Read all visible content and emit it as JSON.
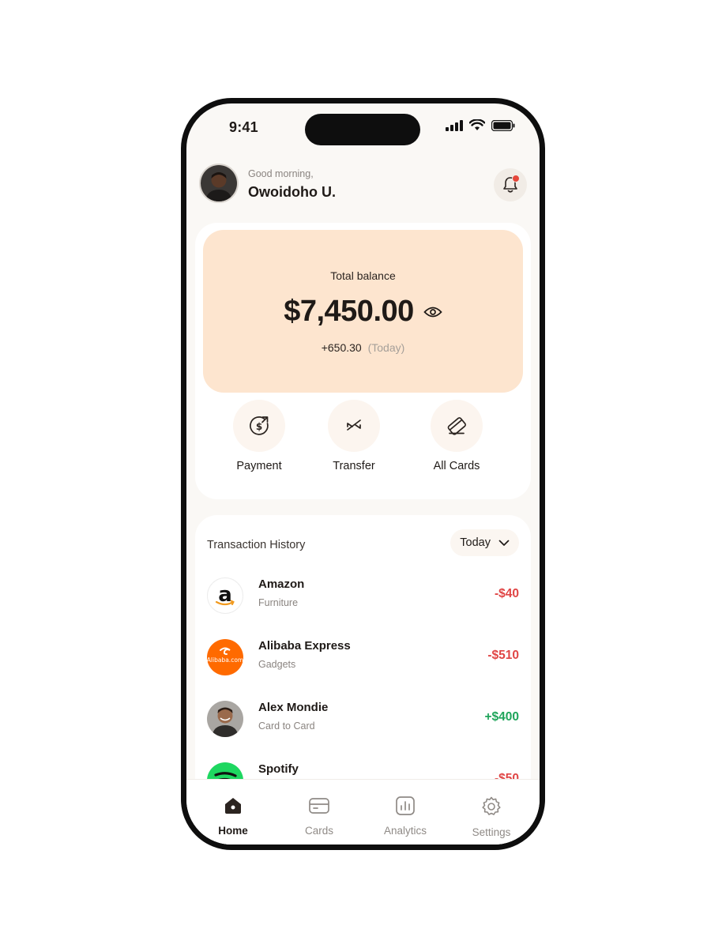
{
  "status": {
    "time": "9:41"
  },
  "header": {
    "greeting": "Good morning,",
    "name": "Owoidoho U."
  },
  "balance": {
    "label": "Total balance",
    "amount": "$7,450.00",
    "change": "+650.30",
    "period": "(Today)"
  },
  "actions": [
    {
      "label": "Payment",
      "icon": "dollar-send-icon"
    },
    {
      "label": "Transfer",
      "icon": "transfer-arrows-icon"
    },
    {
      "label": "All Cards",
      "icon": "cards-icon"
    }
  ],
  "transactions": {
    "title": "Transaction History",
    "filter": "Today",
    "items": [
      {
        "name": "Amazon",
        "category": "Furniture",
        "amount": "-$40",
        "logo": "amazon-logo"
      },
      {
        "name": "Alibaba Express",
        "category": "Gadgets",
        "amount": "-$510",
        "logo": "alibaba-logo",
        "logo_text": "Alibaba.com"
      },
      {
        "name": "Alex Mondie",
        "category": "Card to Card",
        "amount": "+$400",
        "logo": "person-avatar"
      },
      {
        "name": "Spotify",
        "category": "",
        "amount": "-$50",
        "logo": "spotify-logo"
      }
    ]
  },
  "tabs": [
    {
      "label": "Home",
      "icon": "home-icon",
      "active": true
    },
    {
      "label": "Cards",
      "icon": "card-icon",
      "active": false
    },
    {
      "label": "Analytics",
      "icon": "chart-icon",
      "active": false
    },
    {
      "label": "Settings",
      "icon": "gear-icon",
      "active": false
    }
  ],
  "colors": {
    "balance_card": "#fde5cf",
    "negative": "#e04545",
    "positive": "#1ea45a",
    "notification_dot": "#e5463a"
  }
}
